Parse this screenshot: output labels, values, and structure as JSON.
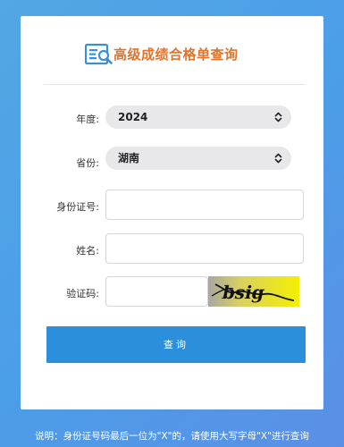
{
  "header": {
    "title": "高级成绩合格单查询",
    "logo_icon": "score-query-icon"
  },
  "form": {
    "year": {
      "label": "年度:",
      "value": "2024"
    },
    "province": {
      "label": "省份:",
      "value": "湖南"
    },
    "id_number": {
      "label": "身份证号:",
      "value": "",
      "placeholder": ""
    },
    "name": {
      "label": "姓名:",
      "value": "",
      "placeholder": ""
    },
    "captcha": {
      "label": "验证码:",
      "value": "",
      "placeholder": "",
      "image_text": "bsig"
    },
    "submit_label": "查询"
  },
  "footer": {
    "note": "说明：身份证号码最后一位为\"X\"的，请使用大写字母\"X\"进行查询"
  },
  "colors": {
    "background": "#4b9ee8",
    "title": "#e0742c",
    "button": "#2c8fdc",
    "captcha_bg": "#f0f000"
  }
}
